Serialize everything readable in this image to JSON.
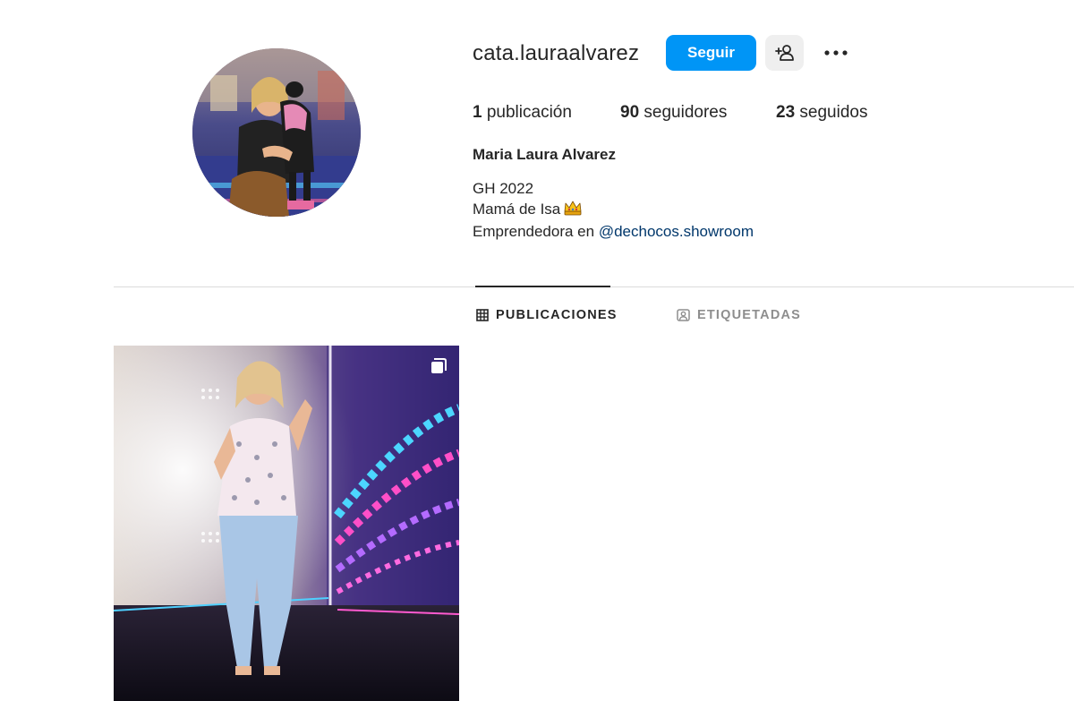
{
  "profile": {
    "username": "cata.lauraalvarez",
    "full_name": "Maria Laura Alvarez",
    "bio": {
      "line1": "GH 2022",
      "line2": "Mamá de Isa",
      "line2_emoji": "crown-emoji",
      "line3_prefix": "Emprendedora en ",
      "line3_mention": "@dechocos.showroom"
    }
  },
  "actions": {
    "follow_label": "Seguir",
    "suggest_icon": "person-add-icon",
    "more_icon": "ellipsis-icon"
  },
  "stats": {
    "posts_count": "1",
    "posts_label": "publicación",
    "followers_count": "90",
    "followers_label": "seguidores",
    "following_count": "23",
    "following_label": "seguidos"
  },
  "tabs": {
    "posts_label": "PUBLICACIONES",
    "posts_icon": "grid-icon",
    "tagged_label": "ETIQUETADAS",
    "tagged_icon": "tagged-person-icon",
    "active": "posts"
  },
  "colors": {
    "accent": "#0095f6",
    "mention": "#00376b",
    "text": "#262626",
    "muted": "#8e8e8e",
    "divider": "#dbdbdb"
  },
  "posts": [
    {
      "type": "carousel",
      "icon": "carousel-icon"
    }
  ]
}
